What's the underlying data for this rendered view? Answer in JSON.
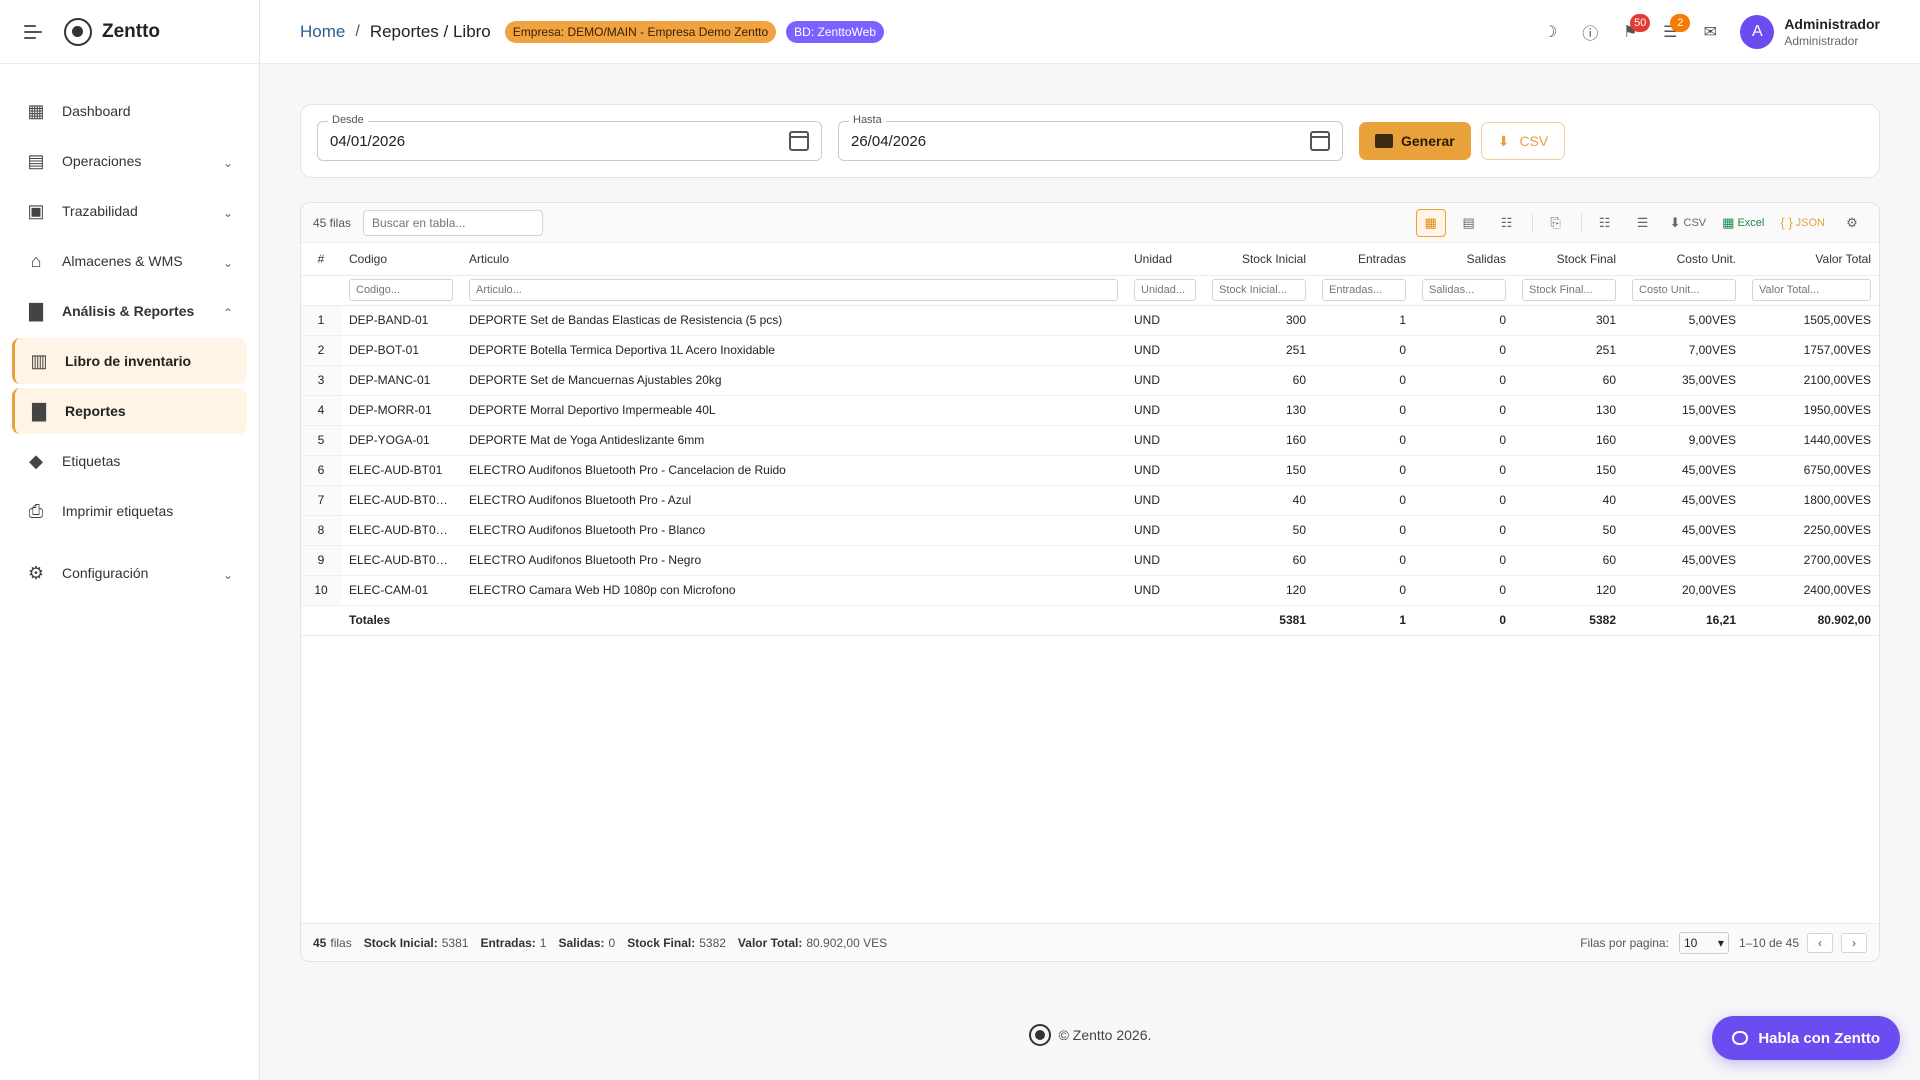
{
  "brand": {
    "name": "Zentto"
  },
  "sidebar": {
    "items": [
      {
        "id": "dashboard",
        "label": "Dashboard",
        "icon": "dashboard-icon",
        "chevron": "",
        "bold": false,
        "active": false
      },
      {
        "id": "operaciones",
        "label": "Operaciones",
        "icon": "inbox-icon",
        "chevron": "down",
        "bold": false,
        "active": false
      },
      {
        "id": "trazabilidad",
        "label": "Trazabilidad",
        "icon": "qr-code-icon",
        "chevron": "down",
        "bold": false,
        "active": false
      },
      {
        "id": "almacenes",
        "label": "Almacenes & WMS",
        "icon": "warehouse-icon",
        "chevron": "down",
        "bold": false,
        "active": false
      },
      {
        "id": "analisis",
        "label": "Análisis & Reportes",
        "icon": "bar-chart-icon",
        "chevron": "up",
        "bold": true,
        "active": false
      },
      {
        "id": "libro",
        "label": "Libro de inventario",
        "icon": "book-icon",
        "chevron": "",
        "bold": false,
        "active": true
      },
      {
        "id": "reportes",
        "label": "Reportes",
        "icon": "bar-chart-icon",
        "chevron": "",
        "bold": false,
        "active": true
      },
      {
        "id": "etiquetas",
        "label": "Etiquetas",
        "icon": "tag-icon",
        "chevron": "",
        "bold": false,
        "active": false
      },
      {
        "id": "imprimir",
        "label": "Imprimir etiquetas",
        "icon": "printer-icon",
        "chevron": "",
        "bold": false,
        "active": false
      },
      {
        "id": "configuracion",
        "label": "Configuración",
        "icon": "gear-icon",
        "chevron": "down",
        "bold": false,
        "active": false
      }
    ]
  },
  "topbar": {
    "breadcrumb_home": "Home",
    "breadcrumb_sep": "/",
    "breadcrumb_current": "Reportes / Libro",
    "empresa_chip": "Empresa: DEMO/MAIN - Empresa Demo Zentto",
    "bd_chip": "BD: ZenttoWeb",
    "notifications_count": "50",
    "tasks_count": "2",
    "avatar_letter": "A",
    "user_name": "Administrador",
    "user_role": "Administrador"
  },
  "filters": {
    "desde_label": "Desde",
    "desde_value": "04/01/2026",
    "hasta_label": "Hasta",
    "hasta_value": "26/04/2026",
    "generar_label": "Generar",
    "csv_label": "CSV"
  },
  "grid": {
    "row_count": "45 filas",
    "search_placeholder": "Buscar en tabla...",
    "toolbar": {
      "csv": "CSV",
      "excel": "Excel",
      "json": "JSON"
    },
    "columns": [
      {
        "key": "idx",
        "label": "#",
        "placeholder": ""
      },
      {
        "key": "codigo",
        "label": "Codigo",
        "placeholder": "Codigo..."
      },
      {
        "key": "articulo",
        "label": "Articulo",
        "placeholder": "Articulo..."
      },
      {
        "key": "unidad",
        "label": "Unidad",
        "placeholder": "Unidad..."
      },
      {
        "key": "stock_inicial",
        "label": "Stock Inicial",
        "placeholder": "Stock Inicial..."
      },
      {
        "key": "entradas",
        "label": "Entradas",
        "placeholder": "Entradas..."
      },
      {
        "key": "salidas",
        "label": "Salidas",
        "placeholder": "Salidas..."
      },
      {
        "key": "stock_final",
        "label": "Stock Final",
        "placeholder": "Stock Final..."
      },
      {
        "key": "costo_unit",
        "label": "Costo Unit.",
        "placeholder": "Costo Unit..."
      },
      {
        "key": "valor_total",
        "label": "Valor Total",
        "placeholder": "Valor Total..."
      }
    ],
    "rows": [
      [
        "1",
        "DEP-BAND-01",
        "DEPORTE Set de Bandas Elasticas de Resistencia (5 pcs)",
        "UND",
        "300",
        "1",
        "0",
        "301",
        "5,00VES",
        "1505,00VES"
      ],
      [
        "2",
        "DEP-BOT-01",
        "DEPORTE Botella Termica Deportiva 1L Acero Inoxidable",
        "UND",
        "251",
        "0",
        "0",
        "251",
        "7,00VES",
        "1757,00VES"
      ],
      [
        "3",
        "DEP-MANC-01",
        "DEPORTE Set de Mancuernas Ajustables 20kg",
        "UND",
        "60",
        "0",
        "0",
        "60",
        "35,00VES",
        "2100,00VES"
      ],
      [
        "4",
        "DEP-MORR-01",
        "DEPORTE Morral Deportivo Impermeable 40L",
        "UND",
        "130",
        "0",
        "0",
        "130",
        "15,00VES",
        "1950,00VES"
      ],
      [
        "5",
        "DEP-YOGA-01",
        "DEPORTE Mat de Yoga Antideslizante 6mm",
        "UND",
        "160",
        "0",
        "0",
        "160",
        "9,00VES",
        "1440,00VES"
      ],
      [
        "6",
        "ELEC-AUD-BT01",
        "ELECTRO Audifonos Bluetooth Pro - Cancelacion de Ruido",
        "UND",
        "150",
        "0",
        "0",
        "150",
        "45,00VES",
        "6750,00VES"
      ],
      [
        "7",
        "ELEC-AUD-BT01-...",
        "ELECTRO Audifonos Bluetooth Pro - Azul",
        "UND",
        "40",
        "0",
        "0",
        "40",
        "45,00VES",
        "1800,00VES"
      ],
      [
        "8",
        "ELEC-AUD-BT01-...",
        "ELECTRO Audifonos Bluetooth Pro - Blanco",
        "UND",
        "50",
        "0",
        "0",
        "50",
        "45,00VES",
        "2250,00VES"
      ],
      [
        "9",
        "ELEC-AUD-BT01-...",
        "ELECTRO Audifonos Bluetooth Pro - Negro",
        "UND",
        "60",
        "0",
        "0",
        "60",
        "45,00VES",
        "2700,00VES"
      ],
      [
        "10",
        "ELEC-CAM-01",
        "ELECTRO Camara Web HD 1080p con Microfono",
        "UND",
        "120",
        "0",
        "0",
        "120",
        "20,00VES",
        "2400,00VES"
      ]
    ],
    "totals": {
      "label": "Totales",
      "stock_inicial": "5381",
      "entradas": "1",
      "salidas": "0",
      "stock_final": "5382",
      "costo_unit": "16,21",
      "valor_total": "80.902,00"
    },
    "footer": {
      "rows_num": "45",
      "rows_word": "filas",
      "stock_inicial_label": "Stock Inicial:",
      "stock_inicial_value": "5381",
      "entradas_label": "Entradas:",
      "entradas_value": "1",
      "salidas_label": "Salidas:",
      "salidas_value": "0",
      "stock_final_label": "Stock Final:",
      "stock_final_value": "5382",
      "valor_total_label": "Valor Total:",
      "valor_total_value": "80.902,00 VES",
      "rows_per_page_label": "Filas por pagina:",
      "rows_per_page_value": "10",
      "range": "1–10 de 45"
    }
  },
  "footer": {
    "copyright": "© Zentto 2026."
  },
  "chat": {
    "label": "Habla con Zentto"
  },
  "colors": {
    "accent": "#e8a13b",
    "purple": "#6a4cf0",
    "link": "#2b5f8f"
  }
}
